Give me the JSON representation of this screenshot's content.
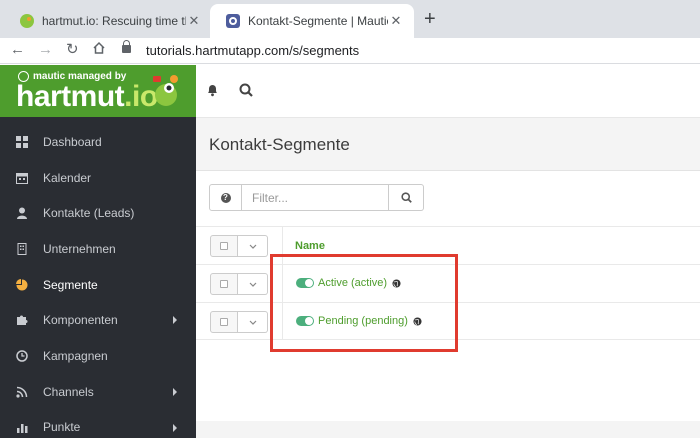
{
  "browser": {
    "tabs": [
      {
        "title": "hartmut.io: Rescuing time throu",
        "favicon": "chameleon-icon"
      },
      {
        "title": "Kontakt-Segmente | Mautic",
        "favicon": "mautic-icon"
      }
    ],
    "url": "tutorials.hartmutapp.com/s/segments"
  },
  "brand": {
    "tagline": "mautic managed by",
    "name": "hartmut",
    "tld": ".io"
  },
  "sidebar": {
    "items": [
      {
        "label": "Dashboard",
        "icon": "dashboard-icon"
      },
      {
        "label": "Kalender",
        "icon": "calendar-icon"
      },
      {
        "label": "Kontakte (Leads)",
        "icon": "user-icon"
      },
      {
        "label": "Unternehmen",
        "icon": "building-icon"
      },
      {
        "label": "Segmente",
        "icon": "pie-chart-icon"
      },
      {
        "label": "Komponenten",
        "icon": "puzzle-icon"
      },
      {
        "label": "Kampagnen",
        "icon": "clock-icon"
      },
      {
        "label": "Channels",
        "icon": "rss-icon"
      },
      {
        "label": "Punkte",
        "icon": "chart-icon"
      }
    ]
  },
  "page": {
    "title": "Kontakt-Segmente",
    "filter_placeholder": "Filter...",
    "table": {
      "column_name": "Name",
      "rows": [
        {
          "label": "Active (active)",
          "published": true
        },
        {
          "label": "Pending (pending)",
          "published": true
        }
      ]
    }
  },
  "colors": {
    "brand_green": "#4e9d2d",
    "sidebar_bg": "#2a2d33",
    "highlight_red": "#e03b2f"
  }
}
